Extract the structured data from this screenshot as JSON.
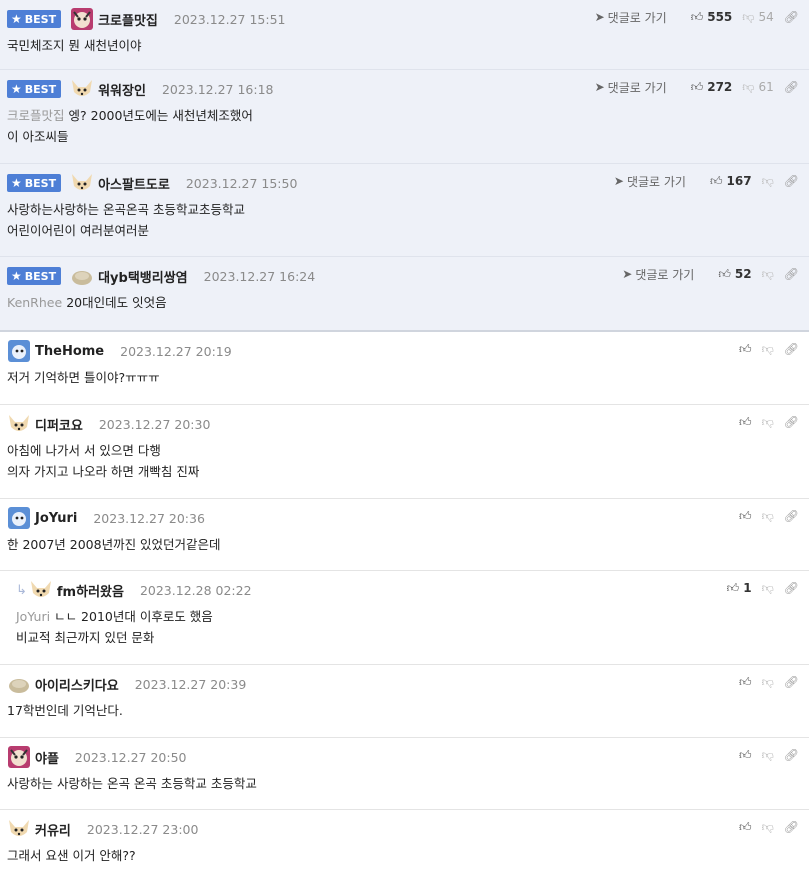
{
  "labels": {
    "best": "BEST",
    "goto_reply": "댓글로 가기"
  },
  "comments": [
    {
      "nick": "크로플맛집",
      "date": "2023.12.27 15:51",
      "likes": "555",
      "dislikes": "54",
      "lines": [
        "국민체조지 뭔 새천년이야"
      ],
      "mention": ""
    },
    {
      "nick": "워워장인",
      "date": "2023.12.27 16:18",
      "likes": "272",
      "dislikes": "61",
      "mention": "크로플맛집",
      "lines": [
        "엥? 2000년도에는 새천년체조했어",
        "이 아조씨들"
      ]
    },
    {
      "nick": "아스팔트도로",
      "date": "2023.12.27 15:50",
      "likes": "167",
      "dislikes": "",
      "mention": "",
      "lines": [
        "사랑하는사랑하는 온곡온곡 초등학교초등학교",
        "어린이어린이 여러분여러분"
      ]
    },
    {
      "nick": "대yb택뱅리쌍염",
      "date": "2023.12.27 16:24",
      "likes": "52",
      "dislikes": "",
      "mention": "KenRhee",
      "lines": [
        "20대인데도 잇엇음"
      ]
    },
    {
      "nick": "TheHome",
      "date": "2023.12.27 20:19",
      "likes": "",
      "mention": "",
      "lines": [
        "저거 기억하면 틀이야?ㅠㅠㅠ"
      ]
    },
    {
      "nick": "디퍼코요",
      "date": "2023.12.27 20:30",
      "likes": "",
      "mention": "",
      "lines": [
        "아침에 나가서 서 있으면 다행",
        "의자 가지고 나오라 하면 개빡침 진짜"
      ]
    },
    {
      "nick": "JoYuri",
      "date": "2023.12.27 20:36",
      "likes": "",
      "mention": "",
      "lines": [
        "한 2007년 2008년까진 있었던거같은데"
      ]
    },
    {
      "nick": "fm하러왔음",
      "date": "2023.12.28 02:22",
      "likes": "1",
      "mention": "JoYuri",
      "lines": [
        "ㄴㄴ 2010년대 이후로도 했음",
        "비교적 최근까지 있던 문화"
      ]
    },
    {
      "nick": "아이리스키다요",
      "date": "2023.12.27 20:39",
      "likes": "",
      "mention": "",
      "lines": [
        "17학번인데 기억난다."
      ]
    },
    {
      "nick": "야플",
      "date": "2023.12.27 20:50",
      "likes": "",
      "mention": "",
      "lines": [
        "사랑하는 사랑하는 온곡 온곡 초등학교 초등학교"
      ]
    },
    {
      "nick": "커유리",
      "date": "2023.12.27 23:00",
      "likes": "",
      "mention": "",
      "lines": [
        "그래서 요샌 이거 안해??"
      ]
    }
  ]
}
